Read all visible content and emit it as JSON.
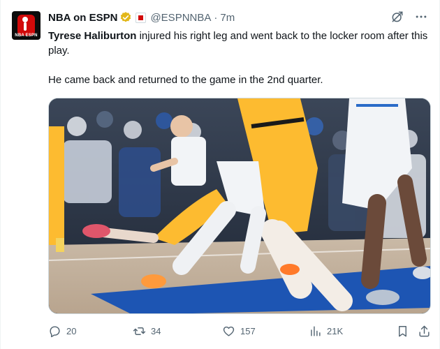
{
  "author": {
    "display_name": "NBA on ESPN",
    "handle": "@ESPNNBA",
    "separator": "·",
    "time": "7m",
    "avatar_text": "NBA ESPN",
    "verified_color": "#e2b719",
    "affiliate_color": "#d20a0a"
  },
  "tweet": {
    "mention_name": "Tyrese Haliburton",
    "line1_rest": " injured his right leg and went back to the locker room after this play.",
    "line2": "He came back and returned to the game in the 2nd quarter."
  },
  "actions": {
    "replies": "20",
    "reposts": "34",
    "likes": "157",
    "views": "21K"
  },
  "icons": {
    "grok": "grok-icon",
    "more": "more-icon",
    "reply": "reply-icon",
    "repost": "repost-icon",
    "like": "heart-icon",
    "views": "views-icon",
    "bookmark": "bookmark-icon",
    "share": "share-icon"
  },
  "colors": {
    "text": "#0f1419",
    "secondary": "#536471",
    "pacers_yellow": "#fdbb30",
    "court_blue": "#1d55b3"
  }
}
